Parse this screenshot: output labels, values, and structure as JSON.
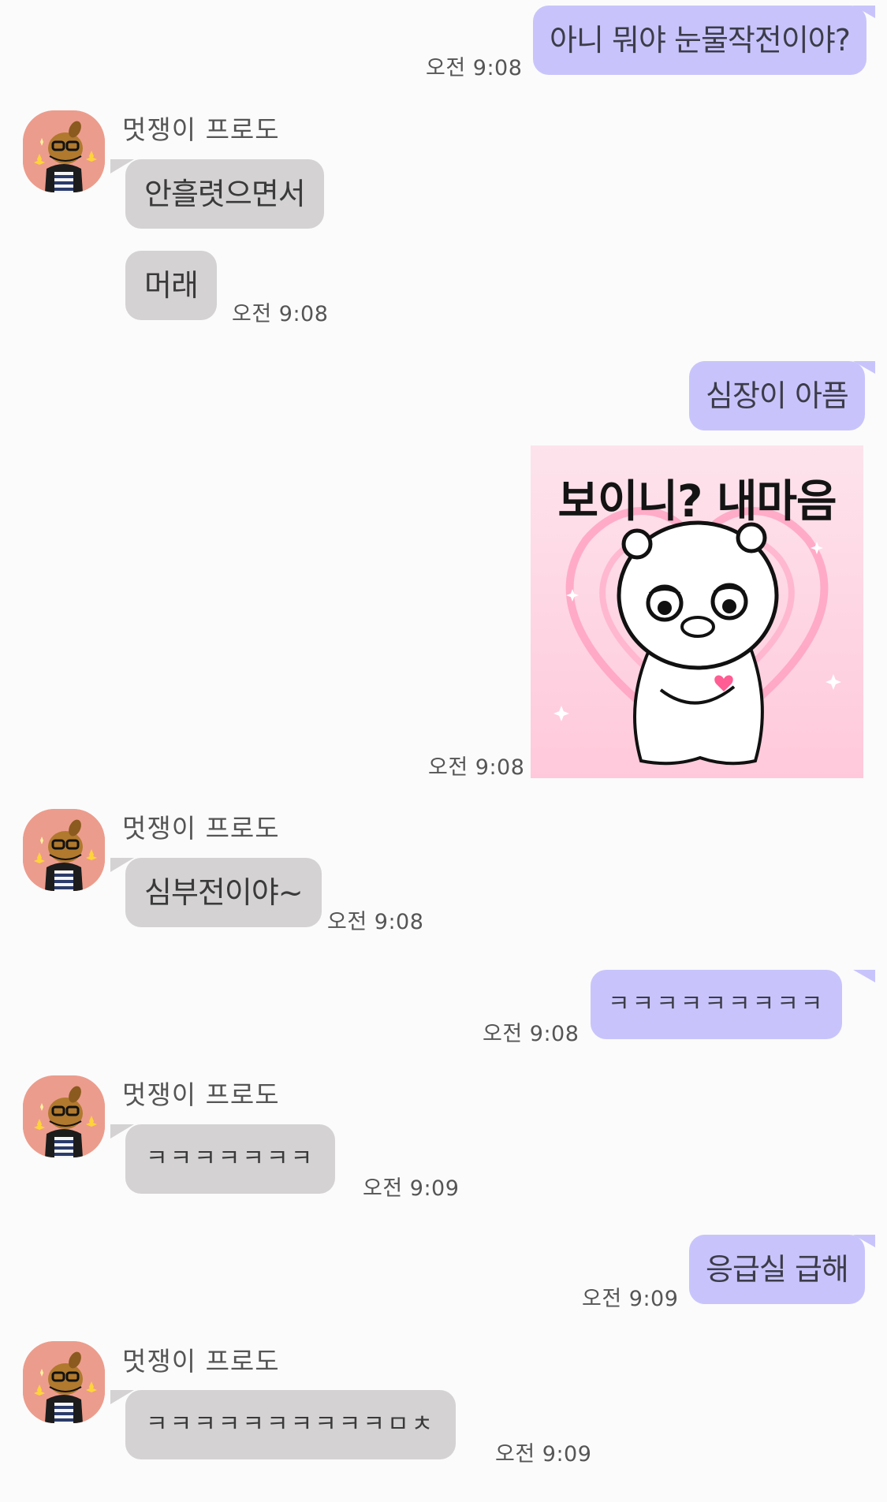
{
  "contact": {
    "name": "멋쟁이 프로도",
    "avatar_icon": "frodo-dog-avatar-icon",
    "avatar_bg": "#ec9c8c"
  },
  "colors": {
    "background": "#fbfbfb",
    "my_bubble": "#c8c4fb",
    "their_bubble": "#d4d2d3",
    "timestamp_text": "#555555"
  },
  "messages": [
    {
      "from": "me",
      "text": "아니 뭐야 눈물작전이야?",
      "time": "오전 9:08"
    },
    {
      "from": "them",
      "text": "안흘렷으면서"
    },
    {
      "from": "them",
      "text": "머래",
      "time": "오전 9:08"
    },
    {
      "from": "me",
      "text": "심장이 아픔"
    },
    {
      "from": "me",
      "type": "sticker",
      "sticker_icon": "crying-bear-heart-sticker-icon",
      "caption": "보이니? 내마음",
      "time": "오전 9:08"
    },
    {
      "from": "them",
      "text": "심부전이야~",
      "time": "오전 9:08"
    },
    {
      "from": "me",
      "text": "ㅋㅋㅋㅋㅋㅋㅋㅋㅋ",
      "time": "오전 9:08"
    },
    {
      "from": "them",
      "text": "ㅋㅋㅋㅋㅋㅋㅋ",
      "time": "오전 9:09"
    },
    {
      "from": "me",
      "text": "응급실 급해",
      "time": "오전 9:09"
    },
    {
      "from": "them",
      "text": "ㅋㅋㅋㅋㅋㅋㅋㅋㅋㅋㅁㅊ",
      "time": "오전 9:09"
    }
  ]
}
